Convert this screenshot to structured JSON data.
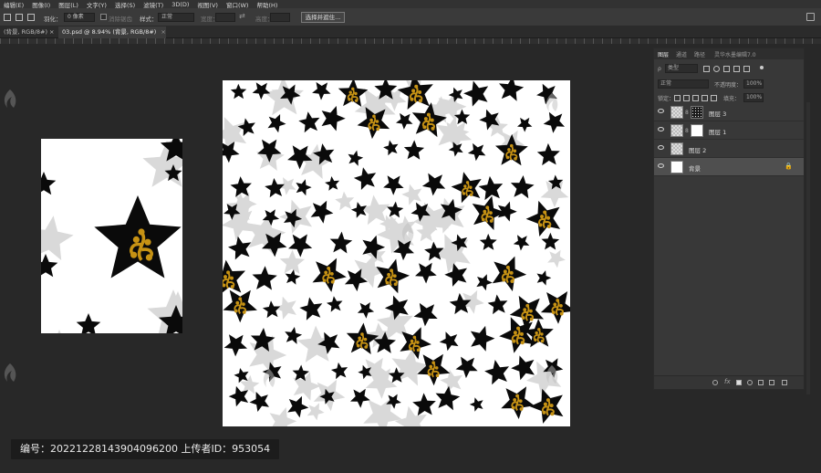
{
  "menu": [
    "编辑(E)",
    "图像(I)",
    "图层(L)",
    "文字(Y)",
    "选择(S)",
    "滤镜(T)",
    "3D(D)",
    "视图(V)",
    "窗口(W)",
    "帮助(H)"
  ],
  "options": {
    "feather_label": "羽化：",
    "feather_value": "0 像素",
    "antialias_label": "消除锯齿",
    "style_label": "样式：",
    "style_value": "正常",
    "width_label": "宽度：",
    "height_label": "高度：",
    "select_button": "选择并遮住..."
  },
  "tabs": [
    {
      "label": "(背景, RGB/8#) ×"
    },
    {
      "label": "03.psd @ 8.94% (背景, RGB/8#)"
    }
  ],
  "layers_panel": {
    "tabs": [
      "图层",
      "通道",
      "路径",
      "灵华水墨编辑7.0"
    ],
    "kind_label": "类型",
    "blend_mode": "正常",
    "opacity_label": "不透明度：",
    "opacity_value": "100%",
    "lock_label": "锁定：",
    "fill_label": "填充：",
    "fill_value": "100%",
    "layers": [
      {
        "name": "图层 3",
        "thumb": "check",
        "mask": "black"
      },
      {
        "name": "图层 1",
        "thumb": "check",
        "mask": "white"
      },
      {
        "name": "图层 2",
        "thumb": "check",
        "mask": ""
      },
      {
        "name": "背景",
        "thumb": "white",
        "mask": "",
        "locked": true
      }
    ]
  },
  "footer": {
    "text": "编号：20221228143904096200 上传者ID：953054"
  },
  "colors": {
    "star_black": "#0a0a0a",
    "star_gray": "#d9d9d9",
    "gold": "#c69214"
  }
}
